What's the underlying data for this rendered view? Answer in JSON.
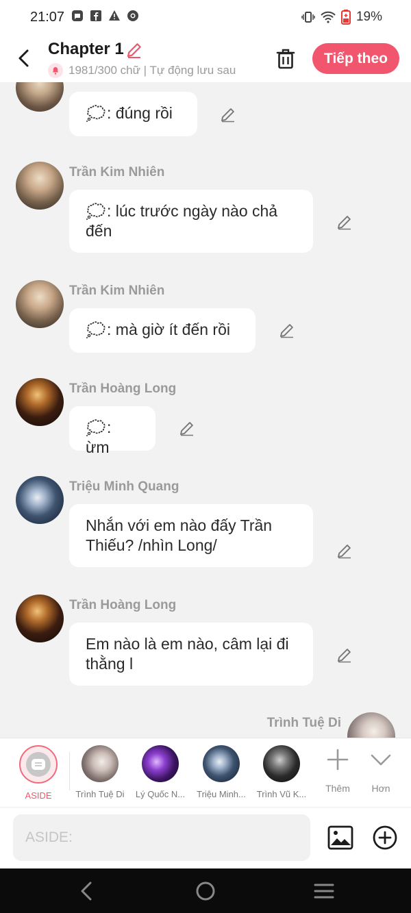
{
  "status": {
    "time": "21:07",
    "battery": "19%"
  },
  "header": {
    "title": "Chapter 1",
    "subtitle": "1981/300 chữ | Tự động lưu sau",
    "next_label": "Tiếp theo"
  },
  "messages": [
    {
      "name": "",
      "text": ": đúng rồi",
      "thought": true
    },
    {
      "name": "Trần Kim Nhiên",
      "text": ": lúc trước ngày nào chả đến",
      "thought": true
    },
    {
      "name": "Trần Kim Nhiên",
      "text": ": mà giờ ít đến rồi",
      "thought": true
    },
    {
      "name": "Trần Hoàng Long",
      "text": ": ừm",
      "thought": true
    },
    {
      "name": "Triệu Minh Quang",
      "text": "Nhắn với em nào đấy Trần Thiếu? /nhìn Long/",
      "thought": false
    },
    {
      "name": "Trần Hoàng Long",
      "text": "Em nào là em nào, câm lại đi thằng l",
      "thought": false
    },
    {
      "name": "Trình Tuệ Di",
      "text": "",
      "thought": false
    }
  ],
  "characters": [
    {
      "label": "ASIDE"
    },
    {
      "label": "Trình Tuệ Di"
    },
    {
      "label": "Lý Quốc N..."
    },
    {
      "label": "Triệu Minh..."
    },
    {
      "label": "Trình Vũ K..."
    }
  ],
  "tools": {
    "more_label": "Thêm",
    "collapse_label": "Hơn"
  },
  "input": {
    "placeholder": "ASIDE:"
  },
  "colors": {
    "accent": "#f2566e",
    "background": "#f2f2f3"
  }
}
